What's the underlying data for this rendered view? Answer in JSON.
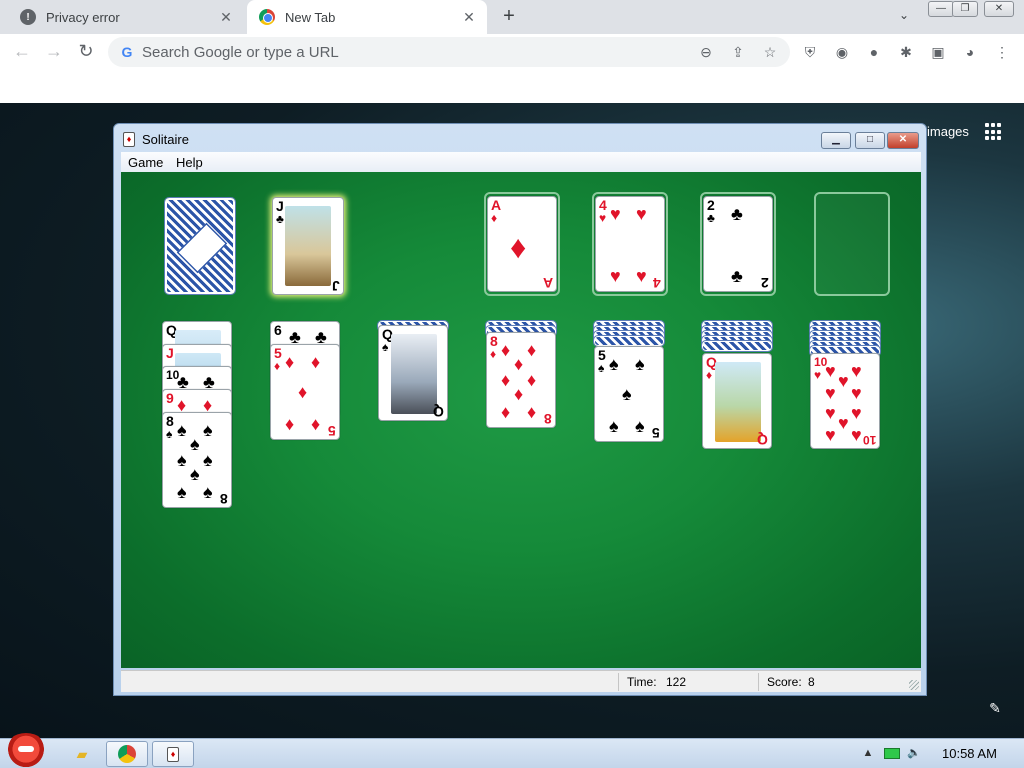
{
  "browser": {
    "tabs": [
      {
        "title": "Privacy error",
        "favicon": "error-icon",
        "active": false
      },
      {
        "title": "New Tab",
        "favicon": "chrome-icon",
        "active": true
      }
    ],
    "omnibox_placeholder": "Search Google or type a URL",
    "page_links": {
      "images": "images"
    }
  },
  "solitaire": {
    "title": "Solitaire",
    "menu": [
      "Game",
      "Help"
    ],
    "status": {
      "time_label": "Time:",
      "time_value": "122",
      "score_label": "Score:",
      "score_value": "8"
    },
    "stock": {
      "state": "face-down"
    },
    "waste": {
      "rank": "J",
      "suit": "♣",
      "color": "black",
      "selected": true
    },
    "foundations": [
      {
        "rank": "A",
        "suit": "♦",
        "color": "red"
      },
      {
        "rank": "4",
        "suit": "♥",
        "color": "red"
      },
      {
        "rank": "2",
        "suit": "♣",
        "color": "black"
      },
      {
        "rank": "",
        "suit": "",
        "color": "empty"
      }
    ],
    "tableau": [
      {
        "cards": [
          {
            "rank": "Q",
            "suit": "♠"
          },
          {
            "rank": "J",
            "suit": "♥"
          },
          {
            "rank": "10",
            "suit": "♣"
          },
          {
            "rank": "9",
            "suit": "♦"
          },
          {
            "rank": "8",
            "suit": "♠"
          }
        ]
      },
      {
        "cards": [
          {
            "rank": "6",
            "suit": "♣"
          },
          {
            "rank": "5",
            "suit": "♦"
          }
        ]
      },
      {
        "cards": [
          {
            "rank": "Q",
            "suit": "♠"
          }
        ]
      },
      {
        "cards": [
          {
            "rank": "8",
            "suit": "♦"
          }
        ]
      },
      {
        "cards": [
          {
            "rank": "5",
            "suit": "♠"
          }
        ]
      },
      {
        "cards": [
          {
            "rank": "Q",
            "suit": "♦"
          }
        ]
      },
      {
        "cards": [
          {
            "rank": "10",
            "suit": "♥"
          }
        ]
      }
    ]
  },
  "taskbar": {
    "clock": "10:58 AM",
    "items": [
      "start-button",
      "explorer",
      "chrome",
      "solitaire"
    ]
  },
  "colors": {
    "felt": "#158a39",
    "red_suit": "#e0142a",
    "black_suit": "#000000"
  }
}
